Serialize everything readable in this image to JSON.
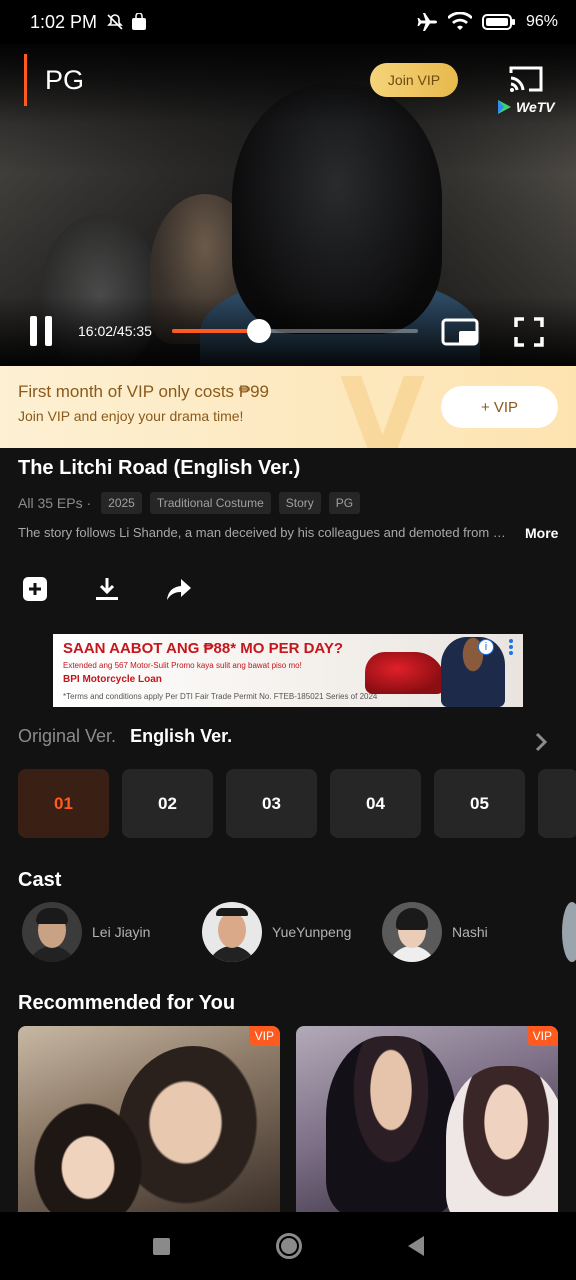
{
  "status_bar": {
    "time": "1:02 PM",
    "battery": "96%",
    "icons": [
      "mute-icon",
      "shop-icon",
      "airplane-icon",
      "wifi-icon",
      "battery-icon"
    ]
  },
  "player": {
    "rating": "PG",
    "join_vip_label": "Join VIP",
    "brand": "WeTV",
    "time": "16:02/45:35",
    "progress": 0.353,
    "accent_color": "#ff5a1f"
  },
  "vip_banner": {
    "line1": "First month of VIP only costs ₱99",
    "line2": "Join VIP and enjoy your drama time!",
    "button_label": "+ VIP",
    "watermark": "V"
  },
  "show": {
    "title": "The Litchi Road (English Ver.)",
    "episode_count": "All 35 EPs ·",
    "tags": [
      "2025",
      "Traditional Costume",
      "Story",
      "PG"
    ],
    "description": "The story follows Li Shande, a man deceived by his colleagues and demoted from his post, who sets out on the road to deliver fresh lychees to the capital.",
    "more_label": "More",
    "actions": [
      "add-to-list-icon",
      "download-icon",
      "share-icon"
    ]
  },
  "ad": {
    "headline": "SAAN AABOT ANG ₱88* MO PER DAY?",
    "subline": "Extended ang 567 Motor-Sulit Promo kaya sulit ang bawat piso mo!",
    "brand": "BPI Motorcycle Loan",
    "fine_print": "*Terms and conditions apply Per DTI Fair Trade Permit No. FTEB-185021 Series of 2024",
    "info_glyph": "i"
  },
  "versions": {
    "original": "Original Ver.",
    "english": "English Ver."
  },
  "episodes": [
    "01",
    "02",
    "03",
    "04",
    "05"
  ],
  "cast": {
    "title": "Cast",
    "members": [
      "Lei Jiayin",
      "YueYunpeng",
      "Nashi"
    ]
  },
  "recommended": {
    "title": "Recommended for You",
    "badge": "VIP"
  }
}
